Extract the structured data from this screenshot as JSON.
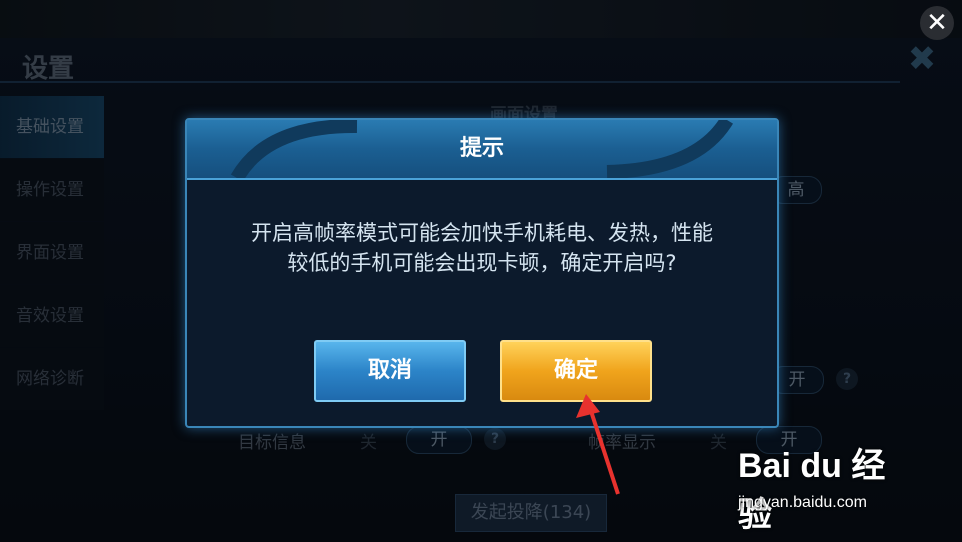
{
  "background": {
    "settings_title": "设置",
    "sidebar": [
      {
        "label": "基础设置",
        "active": true
      },
      {
        "label": "操作设置",
        "active": false
      },
      {
        "label": "界面设置",
        "active": false
      },
      {
        "label": "音效设置",
        "active": false
      },
      {
        "label": "网络诊断",
        "active": false
      }
    ],
    "section_title": "画面设置",
    "partial_high": "高",
    "toggle_on": "开",
    "toggle_off": "关",
    "help": "?",
    "target_info_label": "目标信息",
    "framerate_label": "帧率显示",
    "surrender_label": "发起投降(134)"
  },
  "dialog": {
    "title": "提示",
    "message_line1": "开启高帧率模式可能会加快手机耗电、发热，性能",
    "message_line2": "较低的手机可能会出现卡顿，确定开启吗?",
    "cancel_label": "取消",
    "confirm_label": "确定"
  },
  "watermark": {
    "logo_text": "Bai du 经验",
    "url": "jingyan.baidu.com"
  },
  "colors": {
    "confirm": "#f0a41c",
    "cancel": "#2c84c8",
    "arrow": "#e8322e"
  }
}
